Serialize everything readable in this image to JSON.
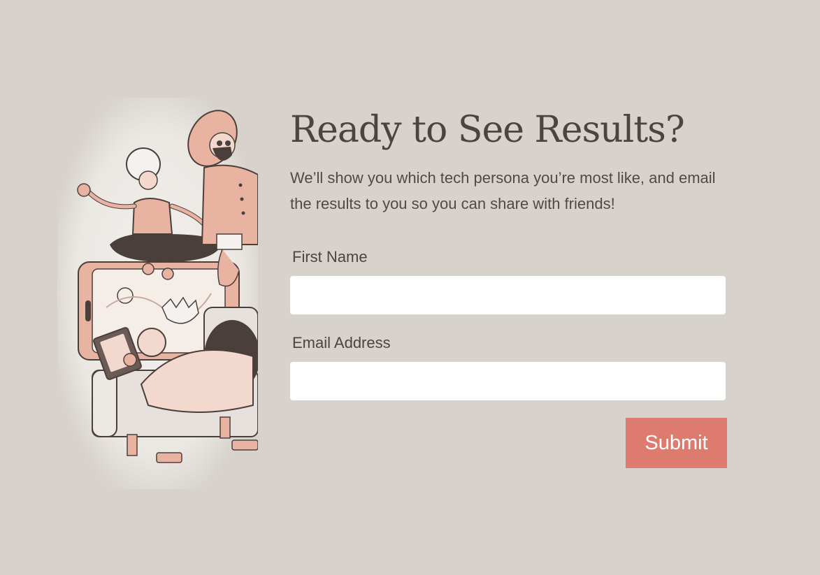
{
  "form": {
    "headline": "Ready to See Results?",
    "subtext": "We’ll show you which tech persona you’re most like, and email the results to you so you can share with friends!",
    "first_name_label": "First Name",
    "first_name_value": "",
    "first_name_placeholder": "",
    "email_label": "Email Address",
    "email_value": "",
    "email_placeholder": "",
    "submit_label": "Submit"
  },
  "colors": {
    "background": "#d7d2cc",
    "accent": "#de7b6f",
    "text": "#4a4540",
    "illustration_peach": "#e9b3a1",
    "illustration_dark": "#4b3f3c"
  },
  "illustration": {
    "icon": "tech-people-illustration-icon"
  }
}
